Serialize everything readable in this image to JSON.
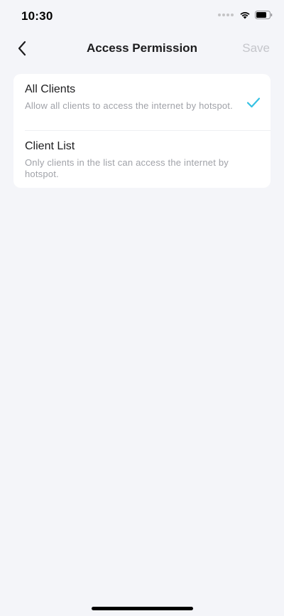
{
  "status_bar": {
    "time": "10:30"
  },
  "nav": {
    "title": "Access Permission",
    "save_label": "Save",
    "back_icon": "chevron-left-icon"
  },
  "options": [
    {
      "title": "All Clients",
      "description": "Allow all clients to access the internet by hotspot.",
      "selected": true
    },
    {
      "title": "Client List",
      "description": "Only clients in the list can access the internet by hotspot.",
      "selected": false
    }
  ],
  "colors": {
    "background": "#f4f5f9",
    "accent_check": "#36c1e3",
    "save_disabled": "#c5c6cb",
    "description": "#a0a2a8"
  }
}
